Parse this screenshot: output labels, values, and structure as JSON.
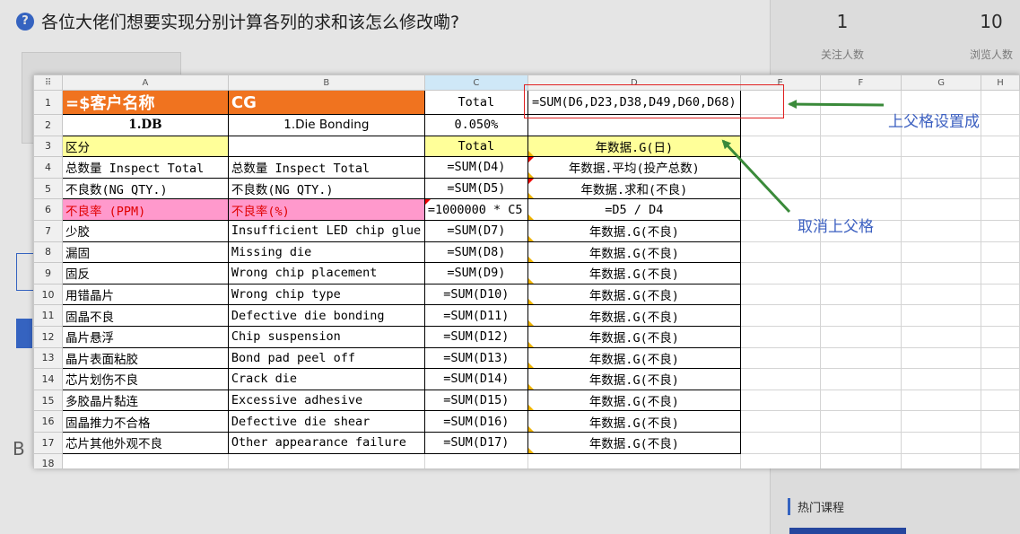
{
  "question": {
    "icon": "?",
    "title": "各位大佬们想要实现分别计算各列的求和该怎么修改嘞?"
  },
  "stats": [
    {
      "value": "1",
      "label": "关注人数"
    },
    {
      "value": "10",
      "label": "浏览人数"
    }
  ],
  "hot_courses_label": "热门课程",
  "sheet": {
    "corner": "⠿",
    "columns": [
      "A",
      "B",
      "C",
      "D",
      "E",
      "F",
      "G",
      "H"
    ],
    "rows": [
      {
        "n": "1",
        "a": "=$客户名称",
        "b": "CG",
        "c": "Total",
        "d": "=SUM(D6,D23,D38,D49,D60,D68)"
      },
      {
        "n": "2",
        "a": "1.DB",
        "b": "1.Die Bonding",
        "c": "0.050%",
        "d": ""
      },
      {
        "n": "3",
        "a": "区分",
        "b": "",
        "c": "Total",
        "d": "年数据.G(日)"
      },
      {
        "n": "4",
        "a": "总数量 Inspect Total",
        "b": "总数量 Inspect Total",
        "c": "=SUM(D4)",
        "d": "年数据.平均(投产总数)"
      },
      {
        "n": "5",
        "a": "不良数(NG QTY.)",
        "b": "不良数(NG QTY.)",
        "c": "=SUM(D5)",
        "d": "年数据.求和(不良)"
      },
      {
        "n": "6",
        "a": "不良率 (PPM)",
        "b": "不良率(%)",
        "c": "=1000000 * C5",
        "d": "=D5 / D4"
      },
      {
        "n": "7",
        "a": "少胶",
        "b": "Insufficient LED chip glue",
        "c": "=SUM(D7)",
        "d": "年数据.G(不良)"
      },
      {
        "n": "8",
        "a": "漏固",
        "b": "Missing die",
        "c": "=SUM(D8)",
        "d": "年数据.G(不良)"
      },
      {
        "n": "9",
        "a": "固反",
        "b": "Wrong chip placement",
        "c": "=SUM(D9)",
        "d": "年数据.G(不良)"
      },
      {
        "n": "10",
        "a": "用错晶片",
        "b": "Wrong chip type",
        "c": "=SUM(D10)",
        "d": "年数据.G(不良)"
      },
      {
        "n": "11",
        "a": "固晶不良",
        "b": "Defective die bonding",
        "c": "=SUM(D11)",
        "d": "年数据.G(不良)"
      },
      {
        "n": "12",
        "a": "晶片悬浮",
        "b": "Chip suspension",
        "c": "=SUM(D12)",
        "d": "年数据.G(不良)"
      },
      {
        "n": "13",
        "a": "晶片表面粘胶",
        "b": "Bond pad peel off",
        "c": "=SUM(D13)",
        "d": "年数据.G(不良)"
      },
      {
        "n": "14",
        "a": "芯片划伤不良",
        "b": "Crack die",
        "c": "=SUM(D14)",
        "d": "年数据.G(不良)"
      },
      {
        "n": "15",
        "a": "多胶晶片黏连",
        "b": "Excessive adhesive",
        "c": "=SUM(D15)",
        "d": "年数据.G(不良)"
      },
      {
        "n": "16",
        "a": "固晶推力不合格",
        "b": "Defective die shear",
        "c": "=SUM(D16)",
        "d": "年数据.G(不良)"
      },
      {
        "n": "17",
        "a": "芯片其他外观不良",
        "b": "Other appearance failure",
        "c": "=SUM(D17)",
        "d": "年数据.G(不良)"
      },
      {
        "n": "18",
        "a": "",
        "b": "",
        "c": "",
        "d": ""
      }
    ]
  },
  "annotations": {
    "set_parent": "上父格设置成",
    "cancel_parent": "取消上父格"
  },
  "colors": {
    "header_orange": "#f0731f",
    "highlight_yellow": "#ffff99",
    "highlight_pink": "#ff99cc",
    "annotation_blue": "#3b5fc0",
    "arrow_green": "#3a8a3a",
    "box_red": "#e02020"
  }
}
